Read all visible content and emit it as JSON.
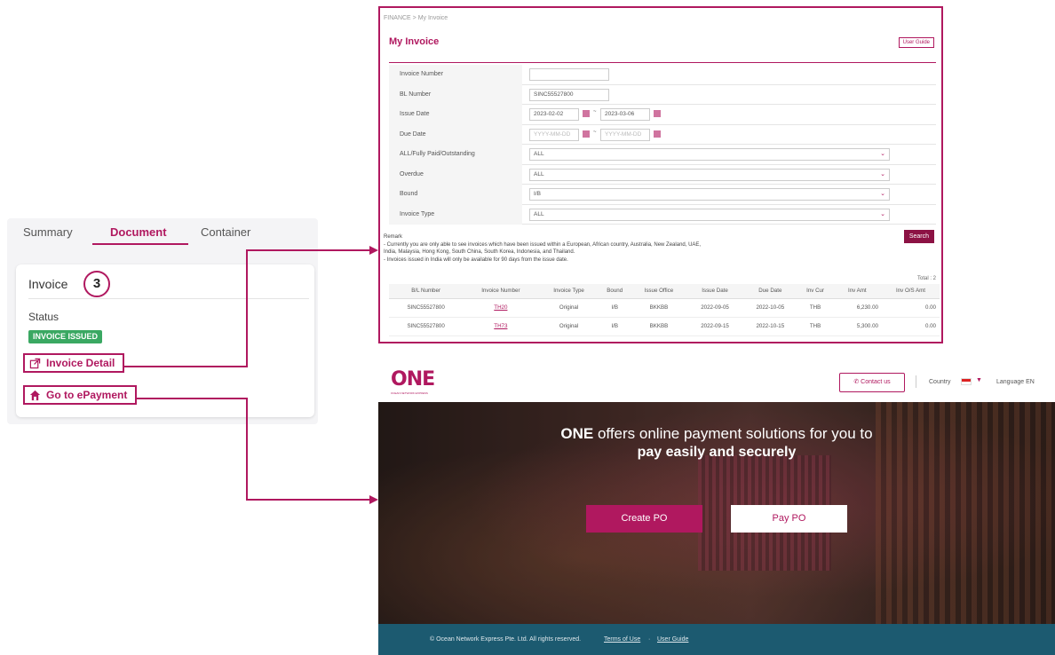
{
  "left_card": {
    "tabs": [
      "Summary",
      "Document",
      "Container"
    ],
    "active_tab": "Document",
    "invoice_title": "Invoice",
    "invoice_count": "3",
    "status_label": "Status",
    "status_badge": "INVOICE ISSUED",
    "invoice_detail_link": "Invoice Detail",
    "epayment_link": "Go to ePayment",
    "accent_color": "#b0185f",
    "badge_color": "#3aa862"
  },
  "invoice_page": {
    "breadcrumb": "FINANCE > My Invoice",
    "title": "My Invoice",
    "user_guide": "User Guide",
    "form": {
      "invoice_number": {
        "label": "Invoice Number",
        "value": ""
      },
      "bl_number": {
        "label": "BL Number",
        "value": "SINC55527800"
      },
      "issue_date": {
        "label": "Issue Date",
        "from": "2023-02-02",
        "to": "2023-03-06",
        "separator": "~"
      },
      "due_date": {
        "label": "Due Date",
        "from_placeholder": "YYYY-MM-DD",
        "to_placeholder": "YYYY-MM-DD",
        "separator": "~"
      },
      "payment_status": {
        "label": "ALL/Fully Paid/Outstanding",
        "value": "ALL"
      },
      "overdue": {
        "label": "Overdue",
        "value": "ALL"
      },
      "bound": {
        "label": "Bound",
        "value": "I/B"
      },
      "invoice_type": {
        "label": "Invoice Type",
        "value": "ALL"
      }
    },
    "remark_title": "Remark",
    "remark_lines": [
      "- Currently you are only able to see invoices which have been issued within a European, African country, Australia, New Zealand, UAE,",
      "  India, Malaysia, Hong Kong, South China, South Korea, Indonesia, and Thailand.",
      "- Invoices issued in India will only be available for 90 days from the issue date."
    ],
    "search_button": "Search",
    "total": "Total : 2",
    "table": {
      "headers": [
        "B/L Number",
        "Invoice Number",
        "Invoice Type",
        "Bound",
        "Issue Office",
        "Issue Date",
        "Due Date",
        "Inv Cur",
        "Inv Amt",
        "Inv O/S Amt"
      ],
      "rows": [
        [
          "SINC55527800",
          "TH20",
          "Original",
          "I/B",
          "BKKBB",
          "2022-09-05",
          "2022-10-05",
          "THB",
          "6,230.00",
          "0.00"
        ],
        [
          "SINC55527800",
          "TH73",
          "Original",
          "I/B",
          "BKKBB",
          "2022-09-15",
          "2022-10-15",
          "THB",
          "5,300.00",
          "0.00"
        ]
      ]
    }
  },
  "epayment_page": {
    "logo": "ONE",
    "logo_tagline": "OCEAN NETWORK EXPRESS",
    "contact_us": "Contact us",
    "country_label": "Country",
    "language_label": "Language",
    "language_value": "EN",
    "hero_brand": "ONE",
    "hero_line1_rest": "offers online payment solutions for you to",
    "hero_line2": "pay easily and securely",
    "create_po": "Create PO",
    "pay_po": "Pay PO",
    "footer_copyright": "© Ocean Network Express Pte. Ltd. All rights reserved.",
    "footer_terms": "Terms of Use",
    "footer_guide": "User Guide",
    "footer_color": "#1c5a70"
  },
  "icons": {
    "external_link": "external-link-icon",
    "home": "home-icon",
    "calendar": "calendar-icon",
    "chevron": "chevron-down-icon",
    "phone": "phone-icon",
    "flag": "flag-icon"
  }
}
